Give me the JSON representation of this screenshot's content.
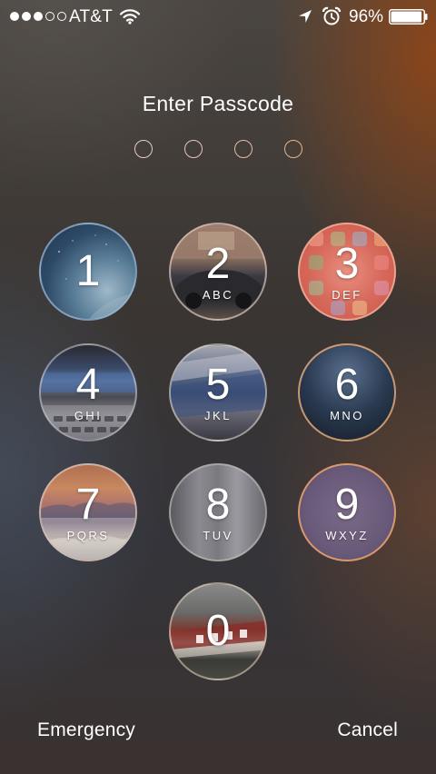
{
  "status_bar": {
    "signal_bars_filled": 3,
    "signal_bars_total": 5,
    "carrier": "AT&T",
    "battery_percent": "96%",
    "battery_level": 0.96
  },
  "title": "Enter Passcode",
  "passcode": {
    "length": 4,
    "entered": 0
  },
  "keys": [
    {
      "digit": "1",
      "letters": ""
    },
    {
      "digit": "2",
      "letters": "ABC"
    },
    {
      "digit": "3",
      "letters": "DEF"
    },
    {
      "digit": "4",
      "letters": "GHI"
    },
    {
      "digit": "5",
      "letters": "JKL"
    },
    {
      "digit": "6",
      "letters": "MNO"
    },
    {
      "digit": "7",
      "letters": "PQRS"
    },
    {
      "digit": "8",
      "letters": "TUV"
    },
    {
      "digit": "9",
      "letters": "WXYZ"
    },
    {
      "digit": "0",
      "letters": ""
    }
  ],
  "footer": {
    "emergency_label": "Emergency",
    "cancel_label": "Cancel"
  },
  "icons": {
    "wifi": "wifi-icon",
    "location": "location-arrow-icon",
    "alarm": "alarm-clock-icon",
    "battery": "battery-icon"
  }
}
